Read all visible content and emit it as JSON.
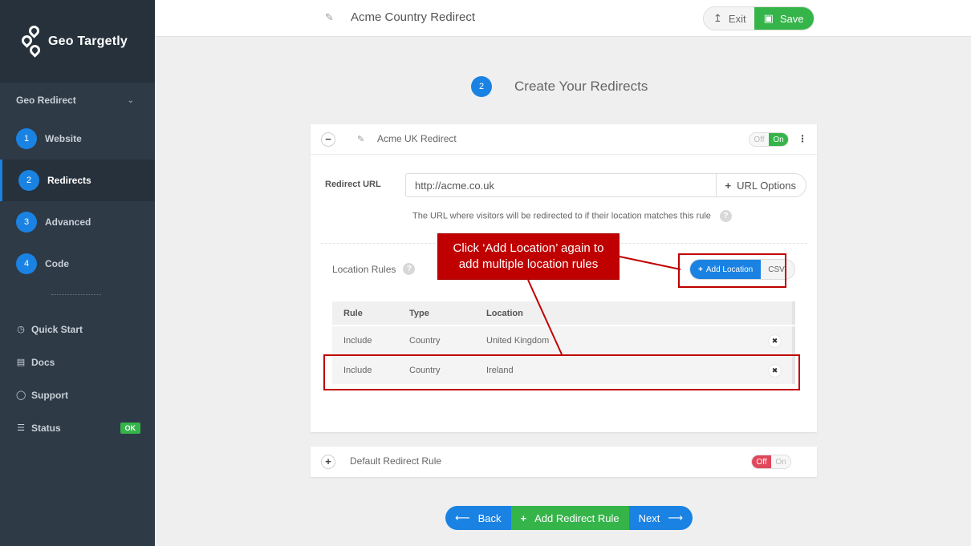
{
  "brand": {
    "name": "Geo Targetly"
  },
  "sidebar": {
    "section_label": "Geo Redirect",
    "steps": [
      {
        "num": "1",
        "label": "Website"
      },
      {
        "num": "2",
        "label": "Redirects"
      },
      {
        "num": "3",
        "label": "Advanced"
      },
      {
        "num": "4",
        "label": "Code"
      }
    ],
    "links": [
      {
        "icon": "clock-icon",
        "label": "Quick Start"
      },
      {
        "icon": "book-icon",
        "label": "Docs"
      },
      {
        "icon": "chat-icon",
        "label": "Support"
      },
      {
        "icon": "database-icon",
        "label": "Status"
      }
    ],
    "status_badge": "OK"
  },
  "topbar": {
    "title": "Acme Country Redirect",
    "exit_label": "Exit",
    "save_label": "Save"
  },
  "step_heading": {
    "num": "2",
    "title": "Create Your Redirects"
  },
  "redirect_card": {
    "name": "Acme UK Redirect",
    "toggle": {
      "off": "Off",
      "on": "On",
      "state": "on"
    },
    "redirect_url_label": "Redirect URL",
    "redirect_url_value": "http://acme.co.uk",
    "url_options_label": "URL Options",
    "hint": "The URL where visitors will be redirected to if their location matches this rule",
    "location_rules_label": "Location Rules",
    "add_location_label": "Add Location",
    "csv_label": "CSV",
    "table": {
      "headers": [
        "Rule",
        "Type",
        "Location"
      ],
      "rows": [
        {
          "rule": "Include",
          "type": "Country",
          "location": "United Kingdom"
        },
        {
          "rule": "Include",
          "type": "Country",
          "location": "Ireland"
        }
      ]
    }
  },
  "default_card": {
    "name": "Default Redirect Rule",
    "toggle": {
      "off": "Off",
      "on": "On",
      "state": "off"
    }
  },
  "bottom_nav": {
    "back": "Back",
    "add": "Add Redirect Rule",
    "next": "Next"
  },
  "annotation": {
    "line1": "Click ‘Add Location’ again to",
    "line2": "add multiple location rules"
  },
  "colors": {
    "blue": "#1a82e2",
    "green": "#35b44a",
    "red": "#c00000",
    "sidebar": "#2e3a46"
  }
}
